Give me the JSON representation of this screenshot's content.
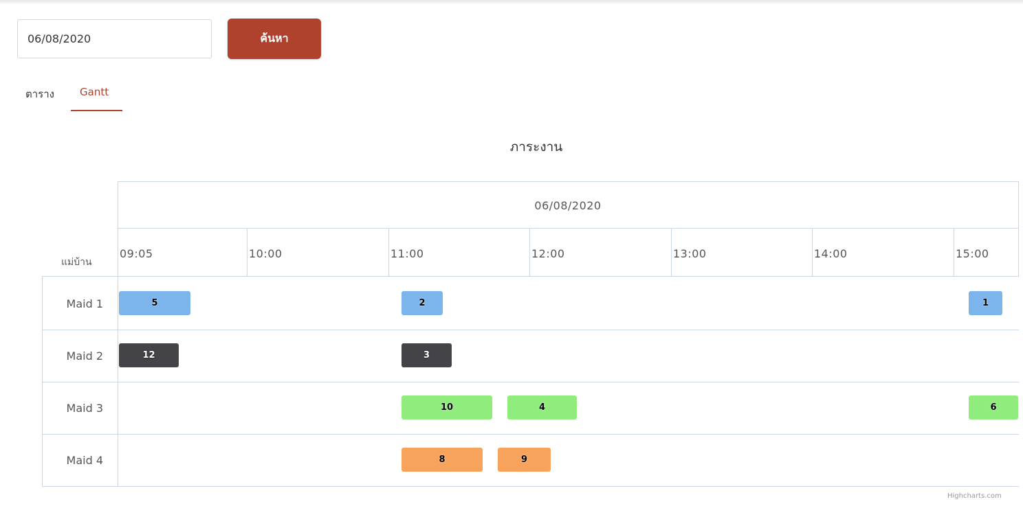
{
  "search": {
    "date_value": "06/08/2020",
    "button_label": "ค้นหา"
  },
  "tabs": [
    {
      "label": "ตาราง",
      "active": false
    },
    {
      "label": "Gantt",
      "active": true
    }
  ],
  "chart_data": {
    "type": "gantt",
    "title": "ภาระงาน",
    "date_header": "06/08/2020",
    "x_start": "09:05",
    "x_ticks": [
      "09:05",
      "10:00",
      "11:00",
      "12:00",
      "13:00",
      "14:00",
      "15:00"
    ],
    "y_axis_title": "แม่บ้าน",
    "categories": [
      "Maid 1",
      "Maid 2",
      "Maid 3",
      "Maid 4"
    ],
    "tasks": [
      {
        "row": "Maid 1",
        "label": "5",
        "start": "09:05",
        "end": "09:36",
        "color": "#7cb5ec"
      },
      {
        "row": "Maid 1",
        "label": "2",
        "start": "11:05",
        "end": "11:23",
        "color": "#7cb5ec"
      },
      {
        "row": "Maid 1",
        "label": "1",
        "start": "15:06",
        "end": "15:21",
        "color": "#7cb5ec"
      },
      {
        "row": "Maid 2",
        "label": "12",
        "start": "09:05",
        "end": "09:31",
        "color": "#434348"
      },
      {
        "row": "Maid 2",
        "label": "3",
        "start": "11:05",
        "end": "11:27",
        "color": "#434348"
      },
      {
        "row": "Maid 3",
        "label": "10",
        "start": "11:05",
        "end": "11:44",
        "color": "#90ed7d"
      },
      {
        "row": "Maid 3",
        "label": "4",
        "start": "11:50",
        "end": "12:20",
        "color": "#90ed7d"
      },
      {
        "row": "Maid 3",
        "label": "6",
        "start": "15:06",
        "end": "15:28",
        "color": "#90ed7d"
      },
      {
        "row": "Maid 4",
        "label": "8",
        "start": "11:05",
        "end": "11:40",
        "color": "#f7a35c"
      },
      {
        "row": "Maid 4",
        "label": "9",
        "start": "11:46",
        "end": "12:09",
        "color": "#f7a35c"
      }
    ]
  },
  "credits": "Highcharts.com"
}
